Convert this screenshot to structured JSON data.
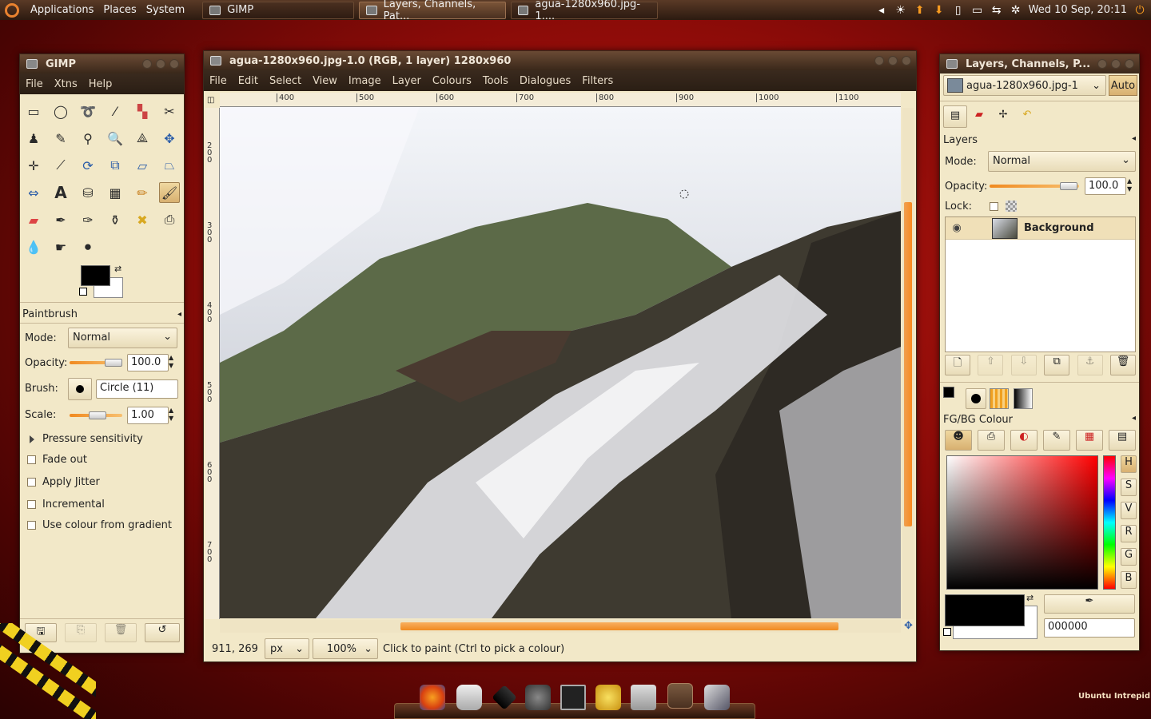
{
  "panel": {
    "menus": [
      "Applications",
      "Places",
      "System"
    ],
    "tasks": [
      "GIMP",
      "Layers, Channels, Pat...",
      "agua-1280x960.jpg-1...."
    ],
    "clock": "Wed 10 Sep, 20:11"
  },
  "toolbox": {
    "title": "GIMP",
    "menu": [
      "File",
      "Xtns",
      "Help"
    ],
    "options_title": "Paintbrush",
    "mode_label": "Mode:",
    "mode_value": "Normal",
    "opacity_label": "Opacity:",
    "opacity_value": "100.0",
    "brush_label": "Brush:",
    "brush_value": "Circle (11)",
    "scale_label": "Scale:",
    "scale_value": "1.00",
    "pressure": "Pressure sensitivity",
    "fade": "Fade out",
    "jitter": "Apply Jitter",
    "incremental": "Incremental",
    "gradient": "Use colour from gradient"
  },
  "image_window": {
    "title": "agua-1280x960.jpg-1.0 (RGB, 1 layer) 1280x960",
    "menu": [
      "File",
      "Edit",
      "Select",
      "View",
      "Image",
      "Layer",
      "Colours",
      "Tools",
      "Dialogues",
      "Filters"
    ],
    "hruler": [
      "400",
      "500",
      "600",
      "700",
      "800",
      "900",
      "1000",
      "1100"
    ],
    "vruler": [
      "2\n0\n0",
      "3\n0\n0",
      "4\n0\n0",
      "5\n0\n0",
      "6\n0\n0",
      "7\n0\n0"
    ],
    "coords": "911, 269",
    "unit": "px",
    "zoom": "100%",
    "status": "Click to paint (Ctrl to pick a colour)"
  },
  "layers": {
    "title": "Layers, Channels, P...",
    "image_select": "agua-1280x960.jpg-1",
    "auto": "Auto",
    "section": "Layers",
    "mode_label": "Mode:",
    "mode_value": "Normal",
    "opacity_label": "Opacity:",
    "opacity_value": "100.0",
    "lock_label": "Lock:",
    "layer_name": "Background",
    "fg_title": "FG/BG Colour",
    "channels": [
      "H",
      "S",
      "V",
      "R",
      "G",
      "B"
    ],
    "hex": "000000"
  },
  "desktop": {
    "watermark": "Ubuntu Intrepid"
  },
  "colors": {
    "accent": "#f08a20",
    "fg": "#000000",
    "bg": "#ffffff"
  }
}
